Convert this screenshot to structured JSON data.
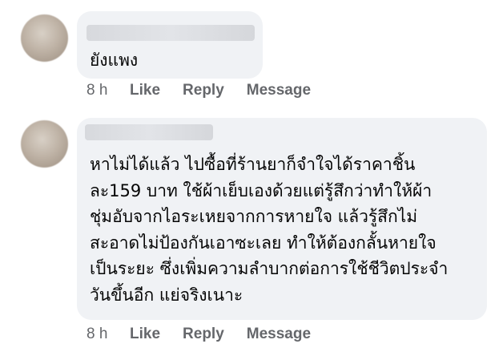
{
  "comments": [
    {
      "text": "ยังแพง",
      "time": "8 h",
      "actions": [
        "Like",
        "Reply",
        "Message"
      ]
    },
    {
      "lines": [
        "หาไม่ได้แล้ว ไปซื้อที่ร้านยาก็จำใจได้ราคาชิ้น",
        "ละ159 บาท ใช้ผ้าเย็บเองด้วยแต่รู้สึกว่าทำให้ผ้า",
        "ชุ่มอับจากไอระเหยจากการหายใจ แล้วรู้สึกไม่",
        "สะอาดไม่ป้องกันเอาซะเลย ทำให้ต้องกลั้นหายใจ",
        "เป็นระยะ ซึ่งเพิ่มความลำบากต่อการใช้ชีวิตประจำ",
        "วันขึ้นอีก แย่จริงเนาะ"
      ],
      "time": "8 h",
      "actions": [
        "Like",
        "Reply",
        "Message"
      ]
    }
  ]
}
